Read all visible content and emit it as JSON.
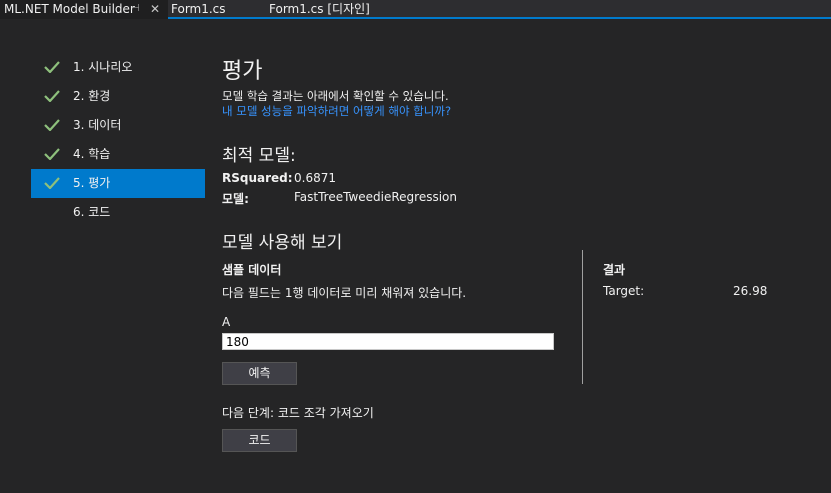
{
  "tabs": [
    {
      "label": "ML.NET Model Builder",
      "active": true
    },
    {
      "label": "Form1.cs",
      "active": false
    },
    {
      "label": "Form1.cs [디자인]",
      "active": false
    }
  ],
  "tab_pin_glyph": "⊣",
  "tab_close_glyph": "✕",
  "steps": [
    {
      "label": "1. 시나리오",
      "done": true
    },
    {
      "label": "2. 환경",
      "done": true
    },
    {
      "label": "3. 데이터",
      "done": true
    },
    {
      "label": "4. 학습",
      "done": true
    },
    {
      "label": "5. 평가",
      "done": true,
      "selected": true
    },
    {
      "label": "6. 코드",
      "done": false
    }
  ],
  "page": {
    "title": "평가",
    "description": "모델 학습 결과는 아래에서 확인할 수 있습니다.",
    "help_link": "내 모델 성능을 파악하려면 어떻게 해야 합니까?"
  },
  "best_model": {
    "heading": "최적 모델:",
    "rsquared_label": "RSquared:",
    "rsquared_value": "0.6871",
    "model_label": "모델:",
    "model_value": "FastTreeTweedieRegression"
  },
  "try_model": {
    "heading": "모델 사용해 보기",
    "sample_heading": "샘플 데이터",
    "sample_desc": "다음 필드는 1행 데이터로 미리 채워져 있습니다.",
    "field_label": "A",
    "field_value": "180",
    "predict_button": "예측",
    "result_heading": "결과",
    "target_label": "Target:",
    "target_value": "26.98"
  },
  "next_step": {
    "text": "다음 단계: 코드 조각 가져오기",
    "code_button": "코드"
  },
  "colors": {
    "accent": "#007acc",
    "check": "#8ec07c",
    "link": "#3794ff",
    "background": "#252526"
  }
}
